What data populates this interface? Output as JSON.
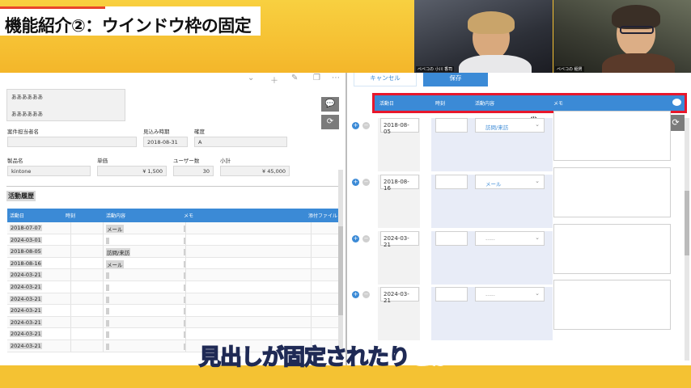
{
  "banner": {
    "title": "機能紹介②：ウインドウ枠の固定",
    "subtitle_main": "見出しが固定されたり",
    "subtitle_highlight": "とか"
  },
  "video": {
    "cam1_name": "ぺぺコの 小川 香司",
    "cam2_name": "ぺぺコの 稲男"
  },
  "left": {
    "textarea_lines": [
      "ああああああ",
      "ああああああ"
    ],
    "fields": {
      "owner_label": "案件担当者名",
      "owner_value": "",
      "expected_label": "見込み時期",
      "expected_value": "2018-08-31",
      "certainty_label": "確度",
      "certainty_value": "A",
      "product_label": "製品名",
      "product_value": "kintone",
      "unit_price_label": "単価",
      "unit_price_value": "¥ 1,500",
      "users_label": "ユーザー数",
      "users_value": "30",
      "subtotal_label": "小計",
      "subtotal_value": "¥ 45,000"
    },
    "section_title": "活動履歴",
    "table_headers": {
      "date": "活動日",
      "time": "時刻",
      "activity": "活動内容",
      "memo": "メモ",
      "attachment": "添付ファイル"
    },
    "rows": [
      {
        "date": "2018-07-07",
        "activity": "メール"
      },
      {
        "date": "2024-03-01",
        "activity": ""
      },
      {
        "date": "2018-08-05",
        "activity": "訪問/来訪"
      },
      {
        "date": "2018-08-16",
        "activity": "メール"
      },
      {
        "date": "2024-03-21",
        "activity": ""
      },
      {
        "date": "2024-03-21",
        "activity": ""
      },
      {
        "date": "2024-03-21",
        "activity": ""
      },
      {
        "date": "2024-03-21",
        "activity": ""
      },
      {
        "date": "2024-03-21",
        "activity": ""
      },
      {
        "date": "2024-03-21",
        "activity": ""
      },
      {
        "date": "2024-03-21",
        "activity": ""
      }
    ]
  },
  "right": {
    "cancel_label": "キャンセル",
    "save_label": "保存",
    "headers": {
      "date": "活動日",
      "time": "時刻",
      "activity": "活動内容",
      "memo": "メモ"
    },
    "rows": [
      {
        "date": "2018-08-05",
        "activity": "訪問/来訪"
      },
      {
        "date": "2018-08-16",
        "activity": "メール"
      },
      {
        "date": "2024-03-21",
        "activity": "-----"
      },
      {
        "date": "2024-03-21",
        "activity": "-----"
      }
    ]
  },
  "colors": {
    "accent_blue": "#3b8ad6",
    "highlight_red": "#e8172b",
    "banner_yellow": "#f6c233"
  }
}
